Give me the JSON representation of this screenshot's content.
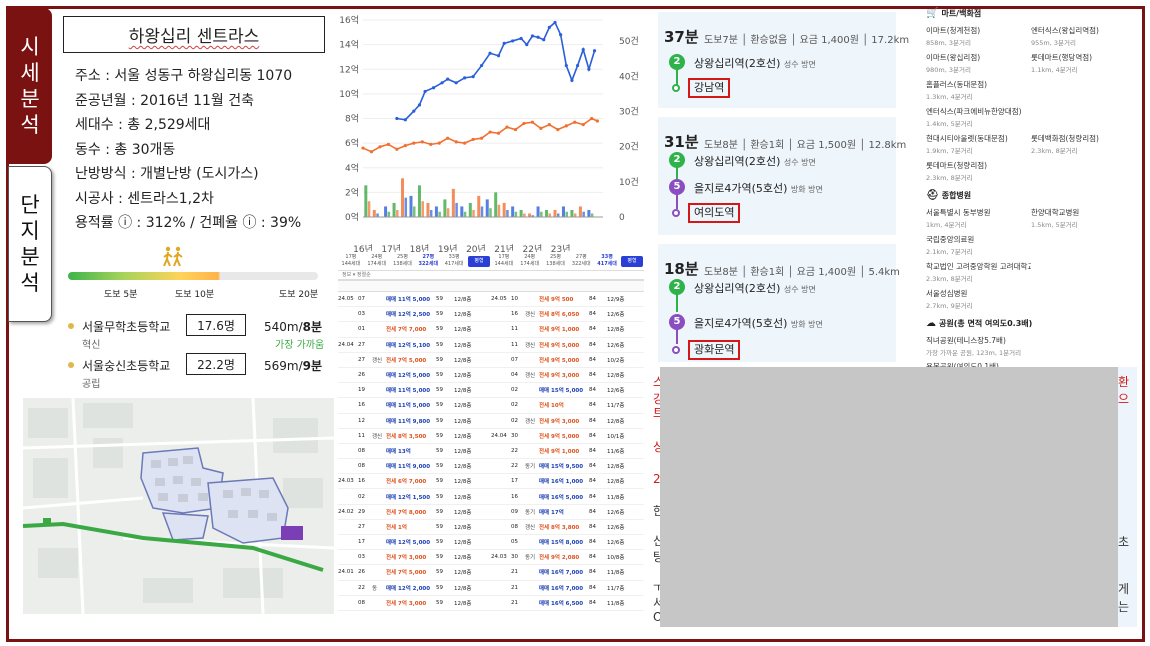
{
  "tabs": [
    {
      "label": "시세분석",
      "chars": [
        "시",
        "세",
        "분",
        "석"
      ],
      "active": true
    },
    {
      "label": "단지분석",
      "chars": [
        "단",
        "지",
        "분",
        "석"
      ],
      "active": false
    }
  ],
  "complex": {
    "name": "하왕십리 센트라스",
    "address": "주소 : 서울 성동구 하왕십리동 1070",
    "completion": "준공년월 : 2016년 11월 건축",
    "households": "세대수 : 총 2,529세대",
    "buildings": "동수 : 총 30개동",
    "heating": "난방방식 : 개별난방 (도시가스)",
    "builder": "시공사 : 센트라스1,2차",
    "ratio": "용적률 ⓘ : 312% / 건폐율 ⓘ : 39%"
  },
  "walk_scale": {
    "labels": [
      "도보 5분",
      "도보 10분",
      "도보 20분"
    ],
    "colors": [
      "#3aa843",
      "#f09a2a",
      "#e05050"
    ],
    "walker_icon": "walking-people-icon"
  },
  "schools": [
    {
      "name": "서울무학초등학교",
      "type": "혁신",
      "students_per_class": "17.6명",
      "distance": "540m/",
      "walk": "8분",
      "note": "가장 가까움"
    },
    {
      "name": "서울숭신초등학교",
      "type": "공립",
      "students_per_class": "22.2명",
      "distance": "569m/",
      "walk": "9분",
      "note": ""
    }
  ],
  "chart_data": {
    "type": "line",
    "x_ticks": [
      "16년",
      "17년",
      "18년",
      "19년",
      "20년",
      "21년",
      "22년",
      "23년"
    ],
    "y_left_ticks": [
      "0억",
      "2억",
      "4억",
      "6억",
      "8억",
      "10억",
      "12억",
      "14억",
      "16억"
    ],
    "y_right_ticks": [
      "0",
      "10건",
      "20건",
      "30건",
      "40건",
      "50건"
    ],
    "ylim_left": [
      0,
      16
    ],
    "ylim_right": [
      0,
      56
    ],
    "series": [
      {
        "color": "#2b5fd9",
        "x": [
          2017.2,
          2017.5,
          2017.8,
          2018.0,
          2018.2,
          2018.5,
          2018.8,
          2019.0,
          2019.3,
          2019.6,
          2019.9,
          2020.2,
          2020.5,
          2020.8,
          2021.0,
          2021.3,
          2021.6,
          2021.8,
          2022.0,
          2022.2,
          2022.4,
          2022.6,
          2022.8,
          2023.0,
          2023.2,
          2023.4,
          2023.6,
          2023.8,
          2024.0,
          2024.2
        ],
        "values": [
          8.0,
          7.9,
          8.6,
          9.1,
          10.2,
          10.5,
          10.9,
          11.2,
          10.9,
          11.3,
          11.4,
          12.3,
          13.3,
          13.1,
          14.1,
          14.3,
          14.5,
          14.0,
          14.7,
          14.6,
          14.4,
          15.4,
          15.8,
          14.8,
          12.3,
          11.1,
          12.3,
          13.6,
          12.0,
          13.5
        ]
      },
      {
        "color": "#f07030",
        "x": [
          2016.0,
          2016.3,
          2016.6,
          2016.9,
          2017.2,
          2017.5,
          2017.8,
          2018.1,
          2018.4,
          2018.7,
          2019.0,
          2019.3,
          2019.6,
          2019.9,
          2020.2,
          2020.5,
          2020.8,
          2021.1,
          2021.4,
          2021.7,
          2022.0,
          2022.3,
          2022.6,
          2022.9,
          2023.2,
          2023.5,
          2023.8,
          2024.1,
          2024.3
        ],
        "values": [
          5.6,
          5.3,
          5.7,
          5.9,
          5.5,
          5.8,
          6.0,
          6.1,
          5.9,
          6.0,
          6.4,
          6.1,
          6.0,
          6.3,
          6.4,
          6.9,
          6.8,
          7.3,
          7.1,
          7.6,
          7.7,
          7.2,
          7.5,
          7.1,
          7.4,
          7.7,
          7.5,
          8.0,
          7.8
        ]
      }
    ],
    "bars": {
      "x": [
        2016.1,
        2016.4,
        2016.8,
        2017.1,
        2017.4,
        2017.7,
        2018.0,
        2018.3,
        2018.6,
        2018.9,
        2019.2,
        2019.5,
        2019.8,
        2020.1,
        2020.4,
        2020.7,
        2021.0,
        2021.3,
        2021.6,
        2021.9,
        2022.2,
        2022.5,
        2022.8,
        2023.1,
        2023.4,
        2023.7,
        2024.0
      ],
      "values": [
        9,
        2,
        3,
        4,
        11,
        6,
        9,
        4,
        3,
        5,
        8,
        3,
        4,
        6,
        5,
        7,
        4,
        3,
        2,
        1,
        3,
        2,
        2,
        3,
        2,
        3,
        2
      ],
      "colors": [
        "#3aa843",
        "#f07030",
        "#2b5fd9"
      ]
    }
  },
  "transactions": {
    "header_tabs": [
      "17평",
      "24평",
      "25평",
      "27평",
      "33평"
    ],
    "header_sub": [
      "144세대",
      "174세대",
      "138세대",
      "322세대",
      "417세대"
    ],
    "button_labels": [
      "평형",
      "평형"
    ],
    "filter_label": "정보 ▾ 정렬순",
    "left": [
      [
        "24.05",
        "07",
        "",
        "매매 11억 5,000",
        "59",
        "12/8층"
      ],
      [
        "",
        "03",
        "",
        "매매 12억 2,500",
        "59",
        "12/8층"
      ],
      [
        "",
        "01",
        "",
        "전세 7억 7,000",
        "59",
        "12/8층"
      ],
      [
        "24.04",
        "27",
        "",
        "매매 12억 5,100",
        "59",
        "12/8층"
      ],
      [
        "",
        "27",
        "갱신",
        "전세 7억 5,000",
        "59",
        "12/8층"
      ],
      [
        "",
        "26",
        "",
        "매매 12억 5,000",
        "59",
        "12/8층"
      ],
      [
        "",
        "19",
        "",
        "매매 11억 5,000",
        "59",
        "12/8층"
      ],
      [
        "",
        "16",
        "",
        "매매 11억 5,000",
        "59",
        "12/8층"
      ],
      [
        "",
        "12",
        "",
        "매매 11억 9,800",
        "59",
        "12/8층"
      ],
      [
        "",
        "11",
        "갱신",
        "전세 8억 3,500",
        "59",
        "12/8층"
      ],
      [
        "",
        "08",
        "",
        "매매 13억",
        "59",
        "12/8층"
      ],
      [
        "",
        "08",
        "",
        "매매 11억 9,000",
        "59",
        "12/8층"
      ],
      [
        "24.03",
        "16",
        "",
        "전세 6억 7,000",
        "59",
        "12/8층"
      ],
      [
        "",
        "02",
        "",
        "매매 12억 1,500",
        "59",
        "12/8층"
      ],
      [
        "24.02",
        "29",
        "",
        "전세 7억 8,000",
        "59",
        "12/8층"
      ],
      [
        "",
        "27",
        "",
        "전세 1억",
        "59",
        "12/8층"
      ],
      [
        "",
        "17",
        "",
        "매매 12억 5,000",
        "59",
        "12/8층"
      ],
      [
        "",
        "03",
        "",
        "전세 7억 3,000",
        "59",
        "12/8층"
      ],
      [
        "24.01",
        "26",
        "",
        "전세 7억 5,000",
        "59",
        "12/8층"
      ],
      [
        "",
        "22",
        "동",
        "매매 12억 2,000",
        "59",
        "12/8층"
      ],
      [
        "",
        "08",
        "",
        "전세 7억 3,000",
        "59",
        "12/8층"
      ]
    ],
    "right": [
      [
        "24.05",
        "10",
        "",
        "전세 9억 500",
        "84",
        "12/9층"
      ],
      [
        "",
        "16",
        "갱신",
        "전세 8억 6,050",
        "84",
        "12/6층"
      ],
      [
        "",
        "11",
        "",
        "전세 9억 1,000",
        "84",
        "12/8층"
      ],
      [
        "",
        "11",
        "갱신",
        "전세 9억 5,000",
        "84",
        "12/6층"
      ],
      [
        "",
        "07",
        "",
        "전세 9억 5,000",
        "84",
        "10/2층"
      ],
      [
        "",
        "04",
        "갱신",
        "전세 9억 3,000",
        "84",
        "12/8층"
      ],
      [
        "",
        "02",
        "",
        "매매 15억 5,000",
        "84",
        "12/6층"
      ],
      [
        "",
        "02",
        "",
        "전세 10억",
        "84",
        "11/7층"
      ],
      [
        "",
        "02",
        "갱신",
        "전세 9억 3,000",
        "84",
        "12/8층"
      ],
      [
        "24.04",
        "30",
        "",
        "전세 9억 5,000",
        "84",
        "10/1층"
      ],
      [
        "",
        "22",
        "",
        "전세 9억 1,000",
        "84",
        "11/6층"
      ],
      [
        "",
        "22",
        "동기",
        "매매 15억 9,500",
        "84",
        "12/8층"
      ],
      [
        "",
        "17",
        "",
        "매매 16억 1,000",
        "84",
        "12/8층"
      ],
      [
        "",
        "16",
        "",
        "매매 16억 5,000",
        "84",
        "11/8층"
      ],
      [
        "",
        "09",
        "동기",
        "매매 17억",
        "84",
        "12/6층"
      ],
      [
        "",
        "08",
        "갱신",
        "전세 8억 3,800",
        "84",
        "12/6층"
      ],
      [
        "",
        "05",
        "",
        "매매 15억 8,000",
        "84",
        "12/6층"
      ],
      [
        "24.03",
        "30",
        "동기",
        "전세 9억 2,080",
        "84",
        "10/8층"
      ],
      [
        "",
        "21",
        "",
        "매매 16억 7,000",
        "84",
        "11/8층"
      ],
      [
        "",
        "21",
        "",
        "매매 16억 7,000",
        "84",
        "11/7층"
      ],
      [
        "",
        "21",
        "",
        "매매 16억 6,500",
        "84",
        "11/8층"
      ]
    ]
  },
  "routes": [
    {
      "time": "37분",
      "meta": "도보7분 │ 환승없음 │ 요금 1,400원 │ 17.2km",
      "stops": [
        {
          "line": "2",
          "name": "상왕십리역(2호선)",
          "dir": "성수 방면"
        }
      ],
      "destination": "강남역",
      "colors": {
        "line2": "#2db34a"
      }
    },
    {
      "time": "31분",
      "meta": "도보8분 │ 환승1회 │ 요금 1,500원 │ 12.8km",
      "stops": [
        {
          "line": "2",
          "name": "상왕십리역(2호선)",
          "dir": "성수 방면"
        },
        {
          "line": "5",
          "name": "을지로4가역(5호선)",
          "dir": "방화 방면"
        }
      ],
      "destination": "여의도역",
      "colors": {
        "line5": "#8b4ec0"
      }
    },
    {
      "time": "18분",
      "meta": "도보8분 │ 환승1회 │ 요금 1,400원 │ 5.4km",
      "stops": [
        {
          "line": "2",
          "name": "상왕십리역(2호선)",
          "dir": "성수 방면"
        },
        {
          "line": "5",
          "name": "을지로4가역(5호선)",
          "dir": "방화 방면"
        }
      ],
      "destination": "광화문역"
    }
  ],
  "facilities": {
    "mart_title": "마트/백화점",
    "mart_items": [
      {
        "name": "이마트(청계천점)",
        "dist": "858m, 3분거리"
      },
      {
        "name": "엔터식스(왕십리역점)",
        "dist": "955m, 3분거리"
      },
      {
        "name": "이마트(왕십리점)",
        "dist": "980m, 3분거리"
      },
      {
        "name": "롯데마트(행당역점)",
        "dist": "1.1km, 4분거리"
      },
      {
        "name": "홈플러스(동대문점)",
        "dist": "1.3km, 4분거리"
      },
      {
        "name": "",
        "dist": ""
      },
      {
        "name": "엔터식스(파크에비뉴한양대점)",
        "dist": "1.4km, 5분거리"
      },
      {
        "name": "",
        "dist": ""
      },
      {
        "name": "현대시티아울렛(동대문점)",
        "dist": "1.9km, 7분거리"
      },
      {
        "name": "롯데백화점(청량리점)",
        "dist": "2.3km, 8분거리"
      },
      {
        "name": "롯데마트(청량리점)",
        "dist": "2.3km, 8분거리"
      },
      {
        "name": "",
        "dist": ""
      }
    ],
    "hospital_title": "종합병원",
    "hospital_items": [
      {
        "name": "서울특별시 동부병원",
        "dist": "1km, 4분거리"
      },
      {
        "name": "한양대학교병원",
        "dist": "1.5km, 5분거리"
      },
      {
        "name": "국립중앙의료원",
        "dist": "2.1km, 7분거리"
      },
      {
        "name": "",
        "dist": ""
      },
      {
        "name": "학교법인 고려중앙학원 고려대학교의과대학부속병원",
        "dist": "2.3km, 8분거리"
      },
      {
        "name": "",
        "dist": ""
      },
      {
        "name": "서울성심병원",
        "dist": "2.7km, 9분거리"
      },
      {
        "name": "",
        "dist": ""
      }
    ],
    "park_title": "공원(총 면적 여의도0.3배)",
    "park_items": [
      {
        "name": "직녀공원(테니스장5.7배)",
        "dist": "가장 가까운 공원, 123m, 1분거리"
      },
      {
        "name": "용봉공원(여의도0.1배)",
        "dist": ""
      }
    ]
  },
  "redacted_fragments": {
    "left_reds": [
      "스",
      "강",
      "트",
      "싱",
      "2"
    ],
    "left_blacks": [
      "한",
      "신",
      "탕",
      "ㅜ",
      "서",
      "O"
    ],
    "right_reds": [
      "환",
      "으"
    ],
    "right_blacks": [
      "초",
      "게",
      "는"
    ]
  }
}
